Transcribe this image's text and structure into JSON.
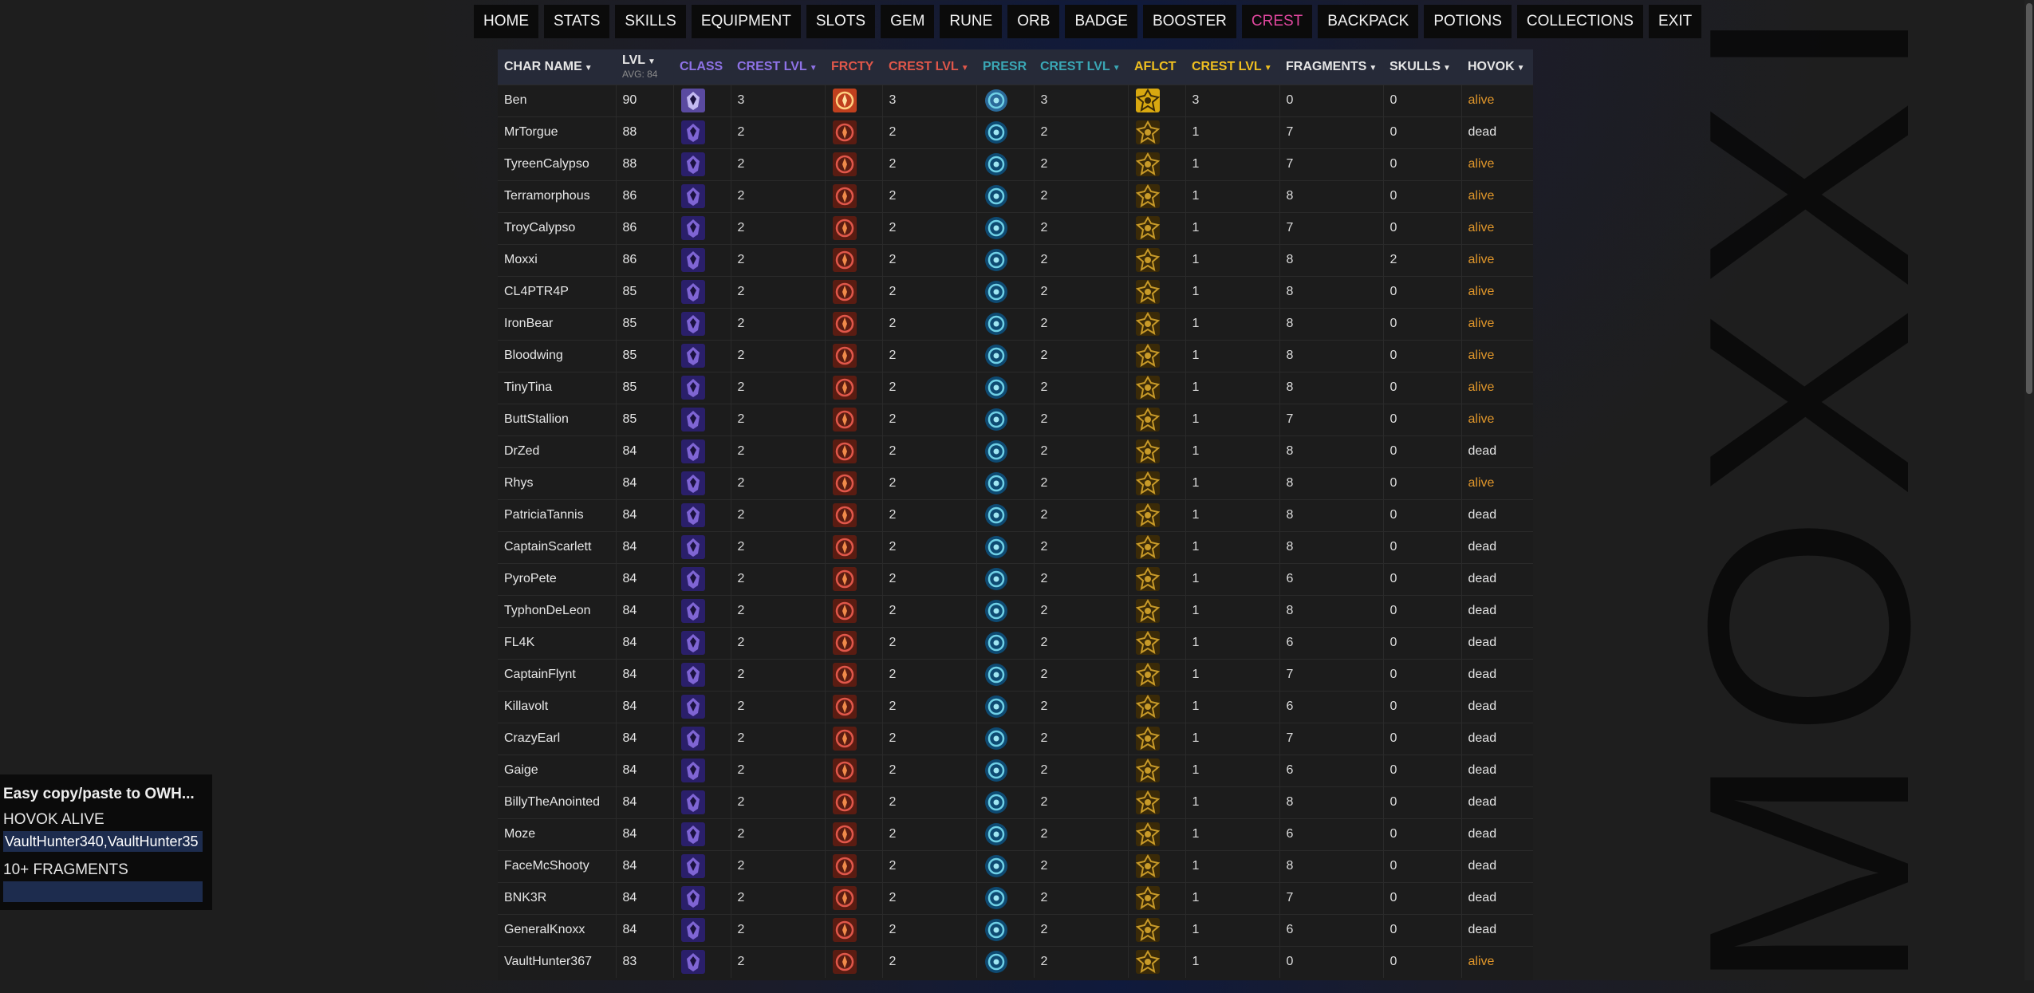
{
  "watermark": "MOXXI",
  "nav": [
    "HOME",
    "STATS",
    "SKILLS",
    "EQUIPMENT",
    "SLOTS",
    "GEM",
    "RUNE",
    "ORB",
    "BADGE",
    "BOOSTER",
    "CREST",
    "BACKPACK",
    "POTIONS",
    "COLLECTIONS",
    "EXIT"
  ],
  "nav_active": "CREST",
  "colors": {
    "class": "#8e72e6",
    "frcty": "#e0574a",
    "presr": "#3aa7b5",
    "aflct": "#f0c020",
    "active_nav": "#e0479e",
    "alive": "#e0962a"
  },
  "headers": {
    "char_name": "CHAR NAME",
    "lvl": "LVL",
    "lvl_avg": "AVG: 84",
    "class": "CLASS",
    "class_crest": "CREST LVL",
    "frcty": "FRCTY",
    "frcty_crest": "CREST LVL",
    "presr": "PRESR",
    "presr_crest": "CREST LVL",
    "aflct": "AFLCT",
    "aflct_crest": "CREST LVL",
    "fragments": "FRAGMENTS",
    "skulls": "SKULLS",
    "hovok": "HOVOK"
  },
  "rows": [
    {
      "name": "Ben",
      "lvl": 90,
      "c1": 3,
      "c2": 3,
      "c3": 3,
      "c4": 3,
      "frag": 0,
      "skulls": 0,
      "hovok": "alive"
    },
    {
      "name": "MrTorgue",
      "lvl": 88,
      "c1": 2,
      "c2": 2,
      "c3": 2,
      "c4": 1,
      "frag": 7,
      "skulls": 0,
      "hovok": "dead"
    },
    {
      "name": "TyreenCalypso",
      "lvl": 88,
      "c1": 2,
      "c2": 2,
      "c3": 2,
      "c4": 1,
      "frag": 7,
      "skulls": 0,
      "hovok": "alive"
    },
    {
      "name": "Terramorphous",
      "lvl": 86,
      "c1": 2,
      "c2": 2,
      "c3": 2,
      "c4": 1,
      "frag": 8,
      "skulls": 0,
      "hovok": "alive"
    },
    {
      "name": "TroyCalypso",
      "lvl": 86,
      "c1": 2,
      "c2": 2,
      "c3": 2,
      "c4": 1,
      "frag": 7,
      "skulls": 0,
      "hovok": "alive"
    },
    {
      "name": "Moxxi",
      "lvl": 86,
      "c1": 2,
      "c2": 2,
      "c3": 2,
      "c4": 1,
      "frag": 8,
      "skulls": 2,
      "hovok": "alive"
    },
    {
      "name": "CL4PTR4P",
      "lvl": 85,
      "c1": 2,
      "c2": 2,
      "c3": 2,
      "c4": 1,
      "frag": 8,
      "skulls": 0,
      "hovok": "alive"
    },
    {
      "name": "IronBear",
      "lvl": 85,
      "c1": 2,
      "c2": 2,
      "c3": 2,
      "c4": 1,
      "frag": 8,
      "skulls": 0,
      "hovok": "alive"
    },
    {
      "name": "Bloodwing",
      "lvl": 85,
      "c1": 2,
      "c2": 2,
      "c3": 2,
      "c4": 1,
      "frag": 8,
      "skulls": 0,
      "hovok": "alive"
    },
    {
      "name": "TinyTina",
      "lvl": 85,
      "c1": 2,
      "c2": 2,
      "c3": 2,
      "c4": 1,
      "frag": 8,
      "skulls": 0,
      "hovok": "alive"
    },
    {
      "name": "ButtStallion",
      "lvl": 85,
      "c1": 2,
      "c2": 2,
      "c3": 2,
      "c4": 1,
      "frag": 7,
      "skulls": 0,
      "hovok": "alive"
    },
    {
      "name": "DrZed",
      "lvl": 84,
      "c1": 2,
      "c2": 2,
      "c3": 2,
      "c4": 1,
      "frag": 8,
      "skulls": 0,
      "hovok": "dead"
    },
    {
      "name": "Rhys",
      "lvl": 84,
      "c1": 2,
      "c2": 2,
      "c3": 2,
      "c4": 1,
      "frag": 8,
      "skulls": 0,
      "hovok": "alive"
    },
    {
      "name": "PatriciaTannis",
      "lvl": 84,
      "c1": 2,
      "c2": 2,
      "c3": 2,
      "c4": 1,
      "frag": 8,
      "skulls": 0,
      "hovok": "dead"
    },
    {
      "name": "CaptainScarlett",
      "lvl": 84,
      "c1": 2,
      "c2": 2,
      "c3": 2,
      "c4": 1,
      "frag": 8,
      "skulls": 0,
      "hovok": "dead"
    },
    {
      "name": "PyroPete",
      "lvl": 84,
      "c1": 2,
      "c2": 2,
      "c3": 2,
      "c4": 1,
      "frag": 6,
      "skulls": 0,
      "hovok": "dead"
    },
    {
      "name": "TyphonDeLeon",
      "lvl": 84,
      "c1": 2,
      "c2": 2,
      "c3": 2,
      "c4": 1,
      "frag": 8,
      "skulls": 0,
      "hovok": "dead"
    },
    {
      "name": "FL4K",
      "lvl": 84,
      "c1": 2,
      "c2": 2,
      "c3": 2,
      "c4": 1,
      "frag": 6,
      "skulls": 0,
      "hovok": "dead"
    },
    {
      "name": "CaptainFlynt",
      "lvl": 84,
      "c1": 2,
      "c2": 2,
      "c3": 2,
      "c4": 1,
      "frag": 7,
      "skulls": 0,
      "hovok": "dead"
    },
    {
      "name": "Killavolt",
      "lvl": 84,
      "c1": 2,
      "c2": 2,
      "c3": 2,
      "c4": 1,
      "frag": 6,
      "skulls": 0,
      "hovok": "dead"
    },
    {
      "name": "CrazyEarl",
      "lvl": 84,
      "c1": 2,
      "c2": 2,
      "c3": 2,
      "c4": 1,
      "frag": 7,
      "skulls": 0,
      "hovok": "dead"
    },
    {
      "name": "Gaige",
      "lvl": 84,
      "c1": 2,
      "c2": 2,
      "c3": 2,
      "c4": 1,
      "frag": 6,
      "skulls": 0,
      "hovok": "dead"
    },
    {
      "name": "BillyTheAnointed",
      "lvl": 84,
      "c1": 2,
      "c2": 2,
      "c3": 2,
      "c4": 1,
      "frag": 8,
      "skulls": 0,
      "hovok": "dead"
    },
    {
      "name": "Moze",
      "lvl": 84,
      "c1": 2,
      "c2": 2,
      "c3": 2,
      "c4": 1,
      "frag": 6,
      "skulls": 0,
      "hovok": "dead"
    },
    {
      "name": "FaceMcShooty",
      "lvl": 84,
      "c1": 2,
      "c2": 2,
      "c3": 2,
      "c4": 1,
      "frag": 8,
      "skulls": 0,
      "hovok": "dead"
    },
    {
      "name": "BNK3R",
      "lvl": 84,
      "c1": 2,
      "c2": 2,
      "c3": 2,
      "c4": 1,
      "frag": 7,
      "skulls": 0,
      "hovok": "dead"
    },
    {
      "name": "GeneralKnoxx",
      "lvl": 84,
      "c1": 2,
      "c2": 2,
      "c3": 2,
      "c4": 1,
      "frag": 6,
      "skulls": 0,
      "hovok": "dead"
    },
    {
      "name": "VaultHunter367",
      "lvl": 83,
      "c1": 2,
      "c2": 2,
      "c3": 2,
      "c4": 1,
      "frag": 0,
      "skulls": 0,
      "hovok": "alive"
    }
  ],
  "side_panel": {
    "title": "Easy copy/paste to OWH...",
    "hovok_label": "HOVOK ALIVE",
    "hovok_value": "VaultHunter340,VaultHunter35",
    "fragments_label": "10+ FRAGMENTS",
    "fragments_value": ""
  }
}
